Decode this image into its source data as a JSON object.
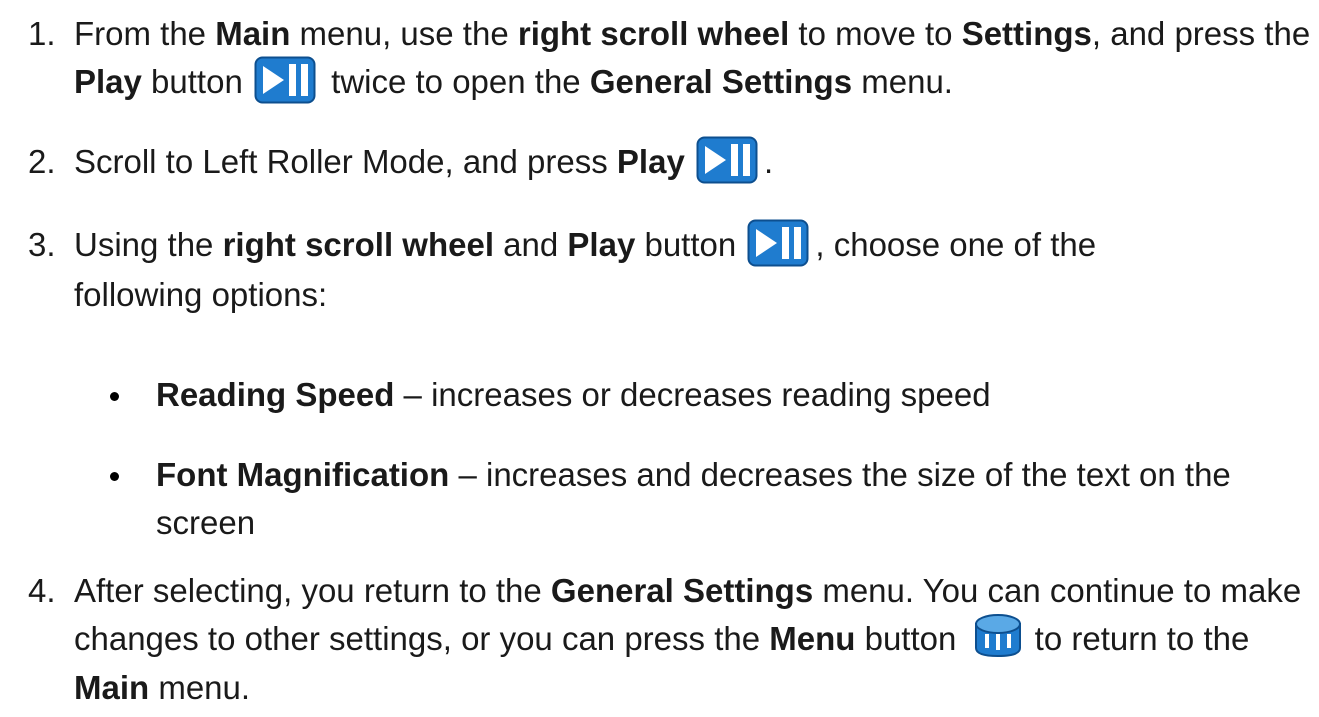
{
  "icons": {
    "play": "play-pause-button-icon",
    "menu": "menu-button-icon",
    "play_color": "#1f7ccf",
    "menu_color": "#1f7ccf"
  },
  "steps": [
    {
      "number": "1.",
      "parts": [
        "From the ",
        "Main",
        " menu, use the ",
        "right scroll wheel",
        " to move to ",
        "Settings",
        ", and press the ",
        "Play",
        " button ",
        " twice to open the ",
        "General Settings",
        " menu."
      ]
    },
    {
      "number": "2.",
      "parts": [
        "Scroll to Left Roller Mode, and press ",
        "Play",
        " ",
        "."
      ]
    },
    {
      "number": "3.",
      "parts": [
        "Using the ",
        "right scroll wheel",
        " and ",
        "Play",
        " button ",
        ", choose one of the following options:"
      ]
    },
    {
      "number": "4.",
      "parts": [
        "After selecting, you return to the ",
        "General Settings",
        " menu. You can continue to make changes to other settings, or you can press the ",
        "Menu",
        " button ",
        " to return to the ",
        "Main",
        " menu."
      ]
    }
  ],
  "options": [
    {
      "term": "Reading Speed",
      "desc": " – increases or decreases reading speed"
    },
    {
      "term": "Font Magnification",
      "desc": " – increases and decreases the size of the text on the screen"
    }
  ]
}
